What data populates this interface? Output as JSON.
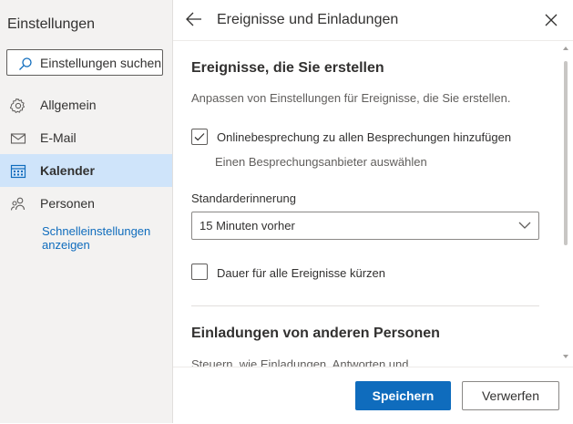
{
  "sidebar": {
    "title": "Einstellungen",
    "search_placeholder": "Einstellungen suchen",
    "items": [
      {
        "label": "Allgemein",
        "icon": "gear-icon",
        "active": false
      },
      {
        "label": "E-Mail",
        "icon": "mail-icon",
        "active": false
      },
      {
        "label": "Kalender",
        "icon": "calendar-icon",
        "active": true
      },
      {
        "label": "Personen",
        "icon": "people-icon",
        "active": false
      }
    ],
    "quick_settings_link": "Schnelleinstellungen anzeigen"
  },
  "panel": {
    "title": "Ereignisse und Einladungen",
    "section1": {
      "title": "Ereignisse, die Sie erstellen",
      "description": "Anpassen von Einstellungen für Ereignisse, die Sie erstellen.",
      "online_meeting_label": "Onlinebesprechung zu allen Besprechungen hinzufügen",
      "online_meeting_checked": true,
      "provider_link": "Einen Besprechungsanbieter auswählen",
      "reminder_label": "Standarderinnerung",
      "reminder_value": "15 Minuten vorher",
      "shorten_label": "Dauer für alle Ereignisse kürzen",
      "shorten_checked": false
    },
    "section2": {
      "title": "Einladungen von anderen Personen",
      "description_partial": "Steuern, wie Einladungen, Antworten und"
    }
  },
  "footer": {
    "save_label": "Speichern",
    "discard_label": "Verwerfen"
  },
  "colors": {
    "accent": "#0f6cbd",
    "active_nav_bg": "#cfe4fa",
    "sidebar_bg": "#f3f2f1"
  }
}
